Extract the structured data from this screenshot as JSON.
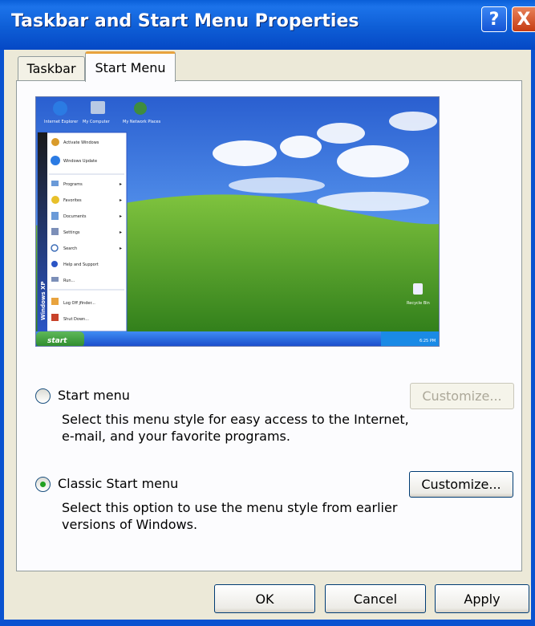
{
  "window": {
    "title": "Taskbar and Start Menu Properties",
    "help_glyph": "?",
    "close_glyph": "X"
  },
  "tabs": [
    {
      "label": "Taskbar"
    },
    {
      "label": "Start Menu"
    }
  ],
  "preview": {
    "start_label": "start",
    "side_banner": "Windows XP",
    "clock": "6:25 PM",
    "desktop_icons": [
      "Internet Explorer",
      "My Computer",
      "My Network Places"
    ],
    "recycle_label": "Recycle Bin",
    "menu_items": [
      "Activate Windows",
      "Windows Update",
      "Programs",
      "Favorites",
      "Documents",
      "Settings",
      "Search",
      "Help and Support",
      "Run...",
      "Log Off jfinder...",
      "Shut Down..."
    ]
  },
  "options": {
    "start_menu": {
      "label": "Start menu",
      "description": "Select this menu style for easy access to the Internet, e-mail, and your favorite programs.",
      "selected": false,
      "customize_label": "Customize...",
      "customize_enabled": false
    },
    "classic_menu": {
      "label": "Classic Start menu",
      "description": "Select this option to use the menu style from earlier versions of Windows.",
      "selected": true,
      "customize_label": "Customize...",
      "customize_enabled": true
    }
  },
  "buttons": {
    "ok": "OK",
    "cancel": "Cancel",
    "apply": "Apply"
  },
  "colors": {
    "titlebar": "#0a5fd8",
    "tab_highlight": "#e8a33e",
    "radio_dot": "#21a121",
    "dialog_bg": "#ece9d8"
  }
}
